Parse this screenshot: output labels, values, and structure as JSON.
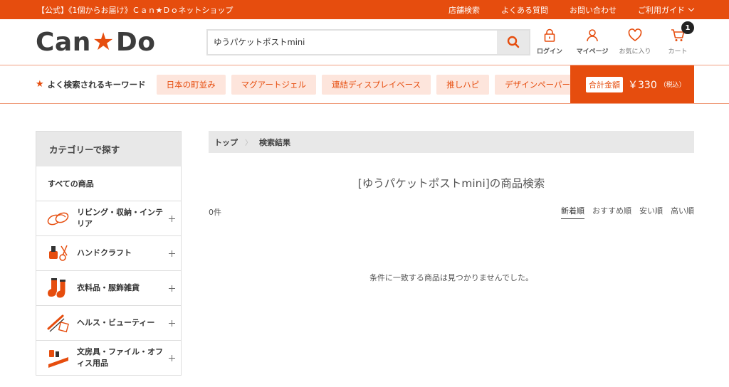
{
  "topbar": {
    "notice": "【公式】《1個からお届け》Ｃａｎ★Ｄｏネットショップ",
    "links": [
      "店舗検索",
      "よくある質問",
      "お問い合わせ",
      "ご利用ガイド"
    ]
  },
  "header": {
    "logo_left": "Can",
    "logo_star": "★",
    "logo_right": "Do",
    "search_value": "ゆうパケットポストmini",
    "icons": {
      "login": "ログイン",
      "mypage": "マイページ",
      "favorites": "お気に入り",
      "cart": "カート",
      "cart_count": "1"
    }
  },
  "keywords": {
    "title": "よく検索されるキーワード",
    "items": [
      "日本の町並み",
      "マグアートジェル",
      "連結ディスプレイベース",
      "推しハピ",
      "デザインペーパー"
    ]
  },
  "total": {
    "label": "合計金額",
    "amount": "￥330",
    "tax": "（税込）"
  },
  "sidebar": {
    "heading": "カテゴリーで探す",
    "all": "すべての商品",
    "categories": [
      {
        "label": "リビング・収納・インテリア",
        "icon": "slippers-icon"
      },
      {
        "label": "ハンドクラフト",
        "icon": "craft-tools-icon"
      },
      {
        "label": "衣料品・服飾雑貨",
        "icon": "socks-icon"
      },
      {
        "label": "ヘルス・ビューティー",
        "icon": "comb-icon"
      },
      {
        "label": "文房具・ファイル・オフィス用品",
        "icon": "stationery-icon"
      }
    ]
  },
  "breadcrumb": [
    "トップ",
    "検索結果"
  ],
  "results": {
    "title": "[ゆうパケットポストmini]の商品検索",
    "count": "0件",
    "sort_options": [
      "新着順",
      "おすすめ順",
      "安い順",
      "高い順"
    ],
    "empty_message": "条件に一致する商品は見つかりませんでした。"
  },
  "colors": {
    "brand": "#e64d0e",
    "keyword_bg": "#fde5dc"
  }
}
